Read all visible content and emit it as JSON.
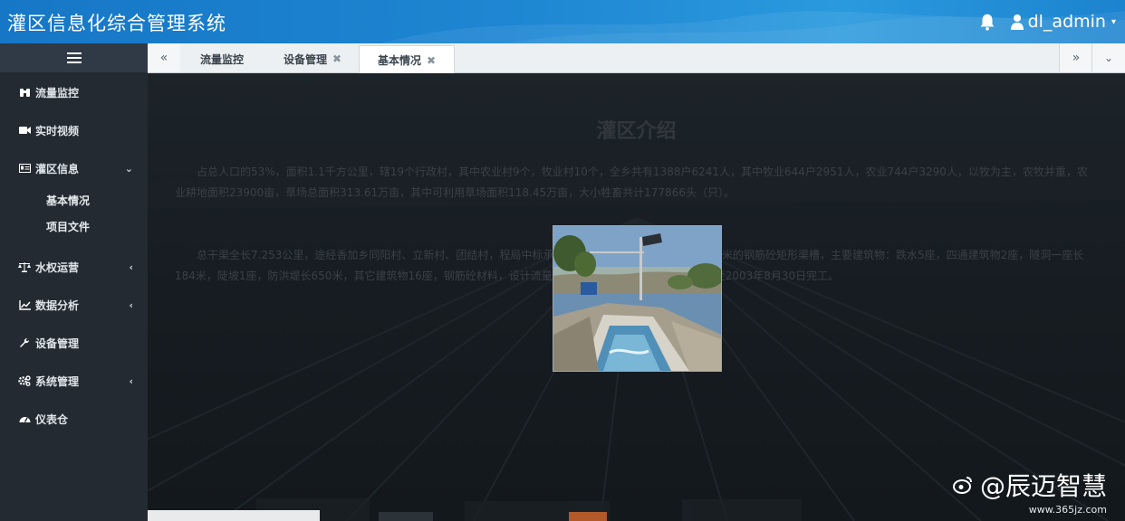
{
  "header": {
    "title": "灌区信息化综合管理系统",
    "user": "dl_admin",
    "icons": [
      "bell-icon",
      "user-icon",
      "caret-down-icon"
    ],
    "accent": "#1e86d2"
  },
  "sidebar": {
    "items": [
      {
        "icon": "binoculars-icon",
        "label": "流量监控"
      },
      {
        "icon": "video-camera-icon",
        "label": "实时视频"
      },
      {
        "icon": "id-card-icon",
        "label": "灌区信息",
        "expanded": true
      },
      {
        "icon": "balance-scale-icon",
        "label": "水权运营"
      },
      {
        "icon": "line-chart-icon",
        "label": "数据分析"
      },
      {
        "icon": "wrench-icon",
        "label": "设备管理"
      },
      {
        "icon": "cogs-icon",
        "label": "系统管理"
      },
      {
        "icon": "dashboard-icon",
        "label": "仪表仓"
      }
    ],
    "subitems": [
      {
        "label": "基本情况"
      },
      {
        "label": "项目文件"
      }
    ],
    "bg": "#232a31"
  },
  "tabs": [
    {
      "label": "流量监控",
      "closable": false
    },
    {
      "label": "设备管理",
      "closable": true,
      "close": "✖"
    },
    {
      "label": "基本情况",
      "closable": true,
      "close": "✖",
      "active": true
    }
  ],
  "document": {
    "title": "灌区介绍",
    "paragraphs": [
      "占总人口的53%，面积1.1千方公里，辖19个行政村，其中农业村9个，牧业村10个，全乡共有1388户6241人，其中牧业644户2951人，农业744户3290人，以牧为主，农牧并重，农业耕地面积23900亩，草场总面积313.61万亩，其中可利用草场面积118.45万亩，大小牲畜共计177866头（只）。",
      "总干渠全长7.253公里，途经香加乡同阳村、立新村、团结村，程局中标承建3+882.95～7+231段，为2×3米的钢筋砼矩形渠槽，主要建筑物：跌水5座，四通建筑物2座，隧洞一座长184米，陡坡1座，防洪堤长650米，其它建筑物16座，钢筋砼材料，设计流量4.36m³/s，2002年7月15日开工至2003年8月30日完工。"
    ]
  },
  "watermark": {
    "brand": "@辰迈智慧",
    "url": "www.365jz.com"
  }
}
